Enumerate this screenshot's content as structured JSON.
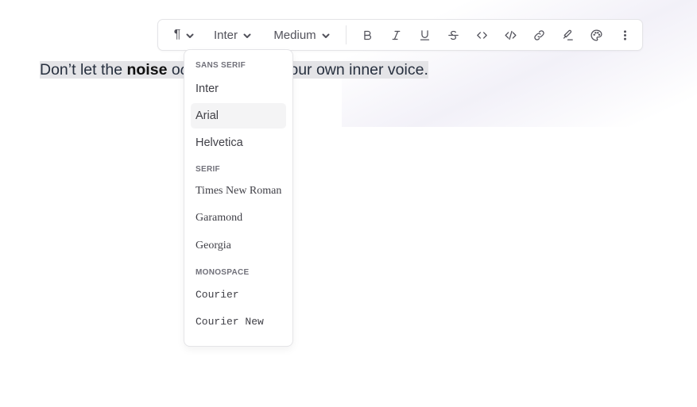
{
  "toolbar": {
    "block_type_icon": "pilcrow-icon",
    "font_family_value": "Inter",
    "font_weight_value": "Medium",
    "icons": [
      "bold-icon",
      "italic-icon",
      "underline-icon",
      "strikethrough-icon",
      "code-icon",
      "code-block-icon",
      "link-icon",
      "highlighter-icon",
      "palette-icon",
      "more-vertical-icon"
    ]
  },
  "editor": {
    "seg1": "Don’t let the ",
    "bold_word": "noise",
    "seg2": " o",
    "italic_frag": "ons",
    "seg3": " drown out your own inner voice."
  },
  "font_menu": {
    "groups": [
      {
        "label": "SANS SERIF",
        "items": [
          "Inter",
          "Arial",
          "Helvetica"
        ]
      },
      {
        "label": "SERIF",
        "items": [
          "Times New Roman",
          "Garamond",
          "Georgia"
        ]
      },
      {
        "label": "MONOSPACE",
        "items": [
          "Courier",
          "Courier New"
        ]
      }
    ],
    "hovered": "Arial"
  }
}
